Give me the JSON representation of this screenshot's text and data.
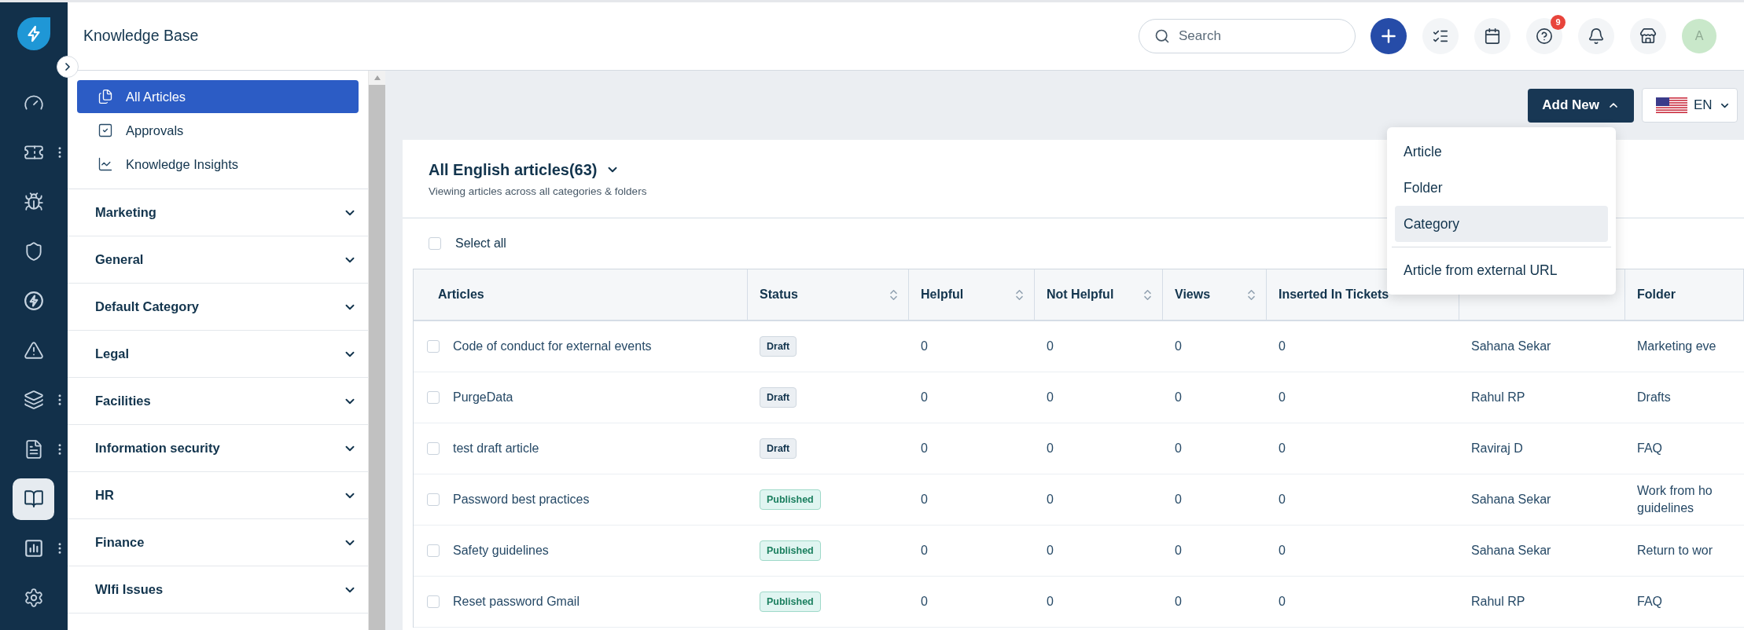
{
  "nav": [
    {
      "selected": false,
      "menu": false
    },
    {
      "selected": false,
      "menu": true
    },
    {
      "selected": false,
      "menu": false
    },
    {
      "selected": false,
      "menu": false
    },
    {
      "selected": false,
      "menu": false
    },
    {
      "selected": false,
      "menu": false
    },
    {
      "selected": false,
      "menu": true
    },
    {
      "selected": false,
      "menu": true
    },
    {
      "selected": true,
      "menu": false
    },
    {
      "selected": false,
      "menu": true
    },
    {
      "selected": false,
      "menu": false
    }
  ],
  "header": {
    "title": "Knowledge Base",
    "search": {
      "placeholder": "Search"
    },
    "help_badge": "9",
    "avatar": "A"
  },
  "sidebar": {
    "links": [
      {
        "label": "All Articles",
        "selected": true
      },
      {
        "label": "Approvals",
        "selected": false
      },
      {
        "label": "Knowledge Insights",
        "selected": false
      }
    ],
    "categories": [
      {
        "label": "Marketing",
        "expanded": false
      },
      {
        "label": "General",
        "expanded": false
      },
      {
        "label": "Default Category",
        "expanded": false
      },
      {
        "label": "Legal",
        "expanded": false
      },
      {
        "label": "Facilities",
        "expanded": false
      },
      {
        "label": "Information security",
        "expanded": false
      },
      {
        "label": "HR",
        "expanded": false
      },
      {
        "label": "Finance",
        "expanded": false
      },
      {
        "label": "WIfi Issues",
        "expanded": false
      }
    ]
  },
  "add_new": {
    "label": "Add New",
    "expanded": true,
    "menu": [
      {
        "label": "Article",
        "selected": false,
        "divider_before": false
      },
      {
        "label": "Folder",
        "selected": false,
        "divider_before": false
      },
      {
        "label": "Category",
        "selected": true,
        "divider_before": false
      },
      {
        "label": "Article from external URL",
        "selected": false,
        "divider_before": true
      }
    ]
  },
  "language": {
    "label": "EN"
  },
  "list": {
    "title": "All English articles(63)",
    "subtitle": "Viewing articles across all categories & folders",
    "select_all": {
      "label": "Select all",
      "checked": false
    }
  },
  "table": {
    "columns": [
      {
        "label": "Articles",
        "sortable": false
      },
      {
        "label": "Status",
        "sortable": true
      },
      {
        "label": "Helpful",
        "sortable": true
      },
      {
        "label": "Not Helpful",
        "sortable": true
      },
      {
        "label": "Views",
        "sortable": true
      },
      {
        "label": "Inserted In Tickets",
        "sortable": false
      },
      {
        "sortable": false
      },
      {
        "label": "Folder",
        "sortable": false
      }
    ],
    "rows": [
      {
        "checked": false,
        "cells": [
          "Code of conduct for external events",
          {
            "label": "Draft",
            "kind": "draft"
          },
          "0",
          "0",
          "0",
          "0",
          "Sahana Sekar",
          "Marketing eve"
        ]
      },
      {
        "checked": false,
        "cells": [
          "PurgeData",
          {
            "label": "Draft",
            "kind": "draft"
          },
          "0",
          "0",
          "0",
          "0",
          "Rahul RP",
          "Drafts"
        ]
      },
      {
        "checked": false,
        "cells": [
          "test draft article",
          {
            "label": "Draft",
            "kind": "draft"
          },
          "0",
          "0",
          "0",
          "0",
          "Raviraj D",
          "FAQ"
        ]
      },
      {
        "checked": false,
        "cells": [
          "Password best practices",
          {
            "label": "Published",
            "kind": "published"
          },
          "0",
          "0",
          "0",
          "0",
          "Sahana Sekar",
          "Work from ho guidelines"
        ]
      },
      {
        "checked": false,
        "cells": [
          "Safety guidelines",
          {
            "label": "Published",
            "kind": "published"
          },
          "0",
          "0",
          "0",
          "0",
          "Sahana Sekar",
          "Return to wor"
        ]
      },
      {
        "checked": false,
        "cells": [
          "Reset password Gmail",
          {
            "label": "Published",
            "kind": "published"
          },
          "0",
          "0",
          "0",
          "0",
          "Rahul RP",
          "FAQ"
        ]
      }
    ]
  }
}
